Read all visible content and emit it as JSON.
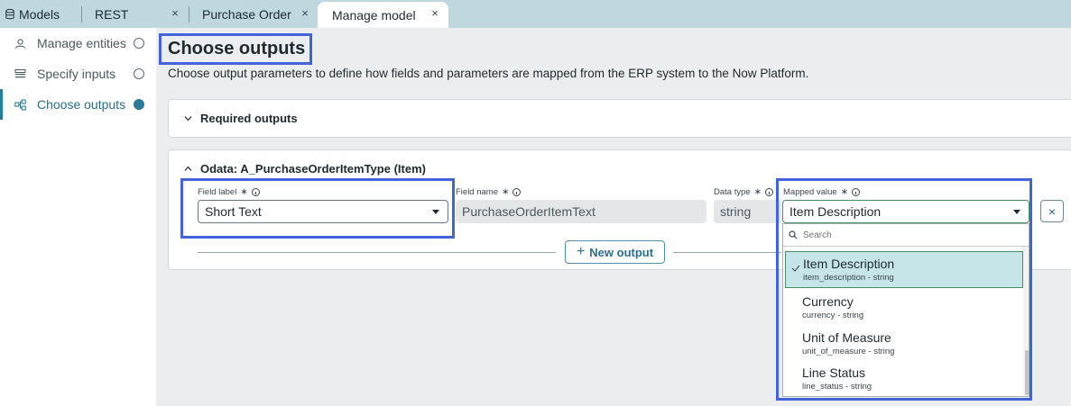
{
  "tabs": {
    "models": "Models",
    "rest": "REST",
    "purchase_order": "Purchase Order ...",
    "manage_model": "Manage model",
    "close_glyph": "×"
  },
  "sidebar": {
    "items": [
      {
        "label": "Manage entities",
        "icon": "entity-icon",
        "active": false
      },
      {
        "label": "Specify inputs",
        "icon": "inputs-icon",
        "active": false
      },
      {
        "label": "Choose outputs",
        "icon": "outputs-icon",
        "active": true
      }
    ]
  },
  "main": {
    "title": "Choose outputs",
    "description": "Choose output parameters to define how fields and parameters are mapped from the ERP system to the Now Platform.",
    "required_section": "Required outputs",
    "odata_section": "Odata: A_PurchaseOrderItemType (Item)",
    "field_label": {
      "label": "Field label",
      "value": "Short Text"
    },
    "field_name": {
      "label": "Field name",
      "value": "PurchaseOrderItemText"
    },
    "data_type": {
      "label": "Data type",
      "value": "string"
    },
    "mapped_value": {
      "label": "Mapped value",
      "value": "Item Description"
    },
    "new_output": "New output",
    "required_marker": "∗"
  },
  "dropdown": {
    "search_placeholder": "Search",
    "options": [
      {
        "label": "Item Description",
        "sub": "item_description - string",
        "selected": true
      },
      {
        "label": "Currency",
        "sub": "currency - string",
        "selected": false
      },
      {
        "label": "Unit of Measure",
        "sub": "unit_of_measure - string",
        "selected": false
      },
      {
        "label": "Line Status",
        "sub": "line_status - string",
        "selected": false
      }
    ]
  },
  "colors": {
    "accent": "#2b7a97",
    "highlight": "#4264d8",
    "selected_bg": "#c6e5e8"
  }
}
